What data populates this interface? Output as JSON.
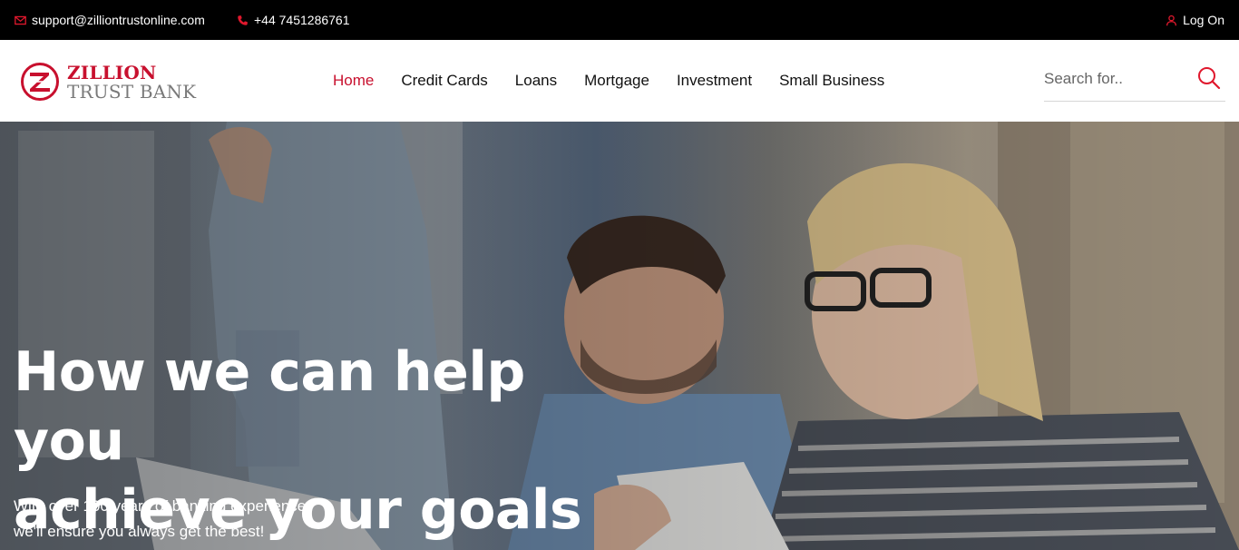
{
  "topbar": {
    "email": "support@zilliontrustonline.com",
    "phone": "+44 7451286761",
    "login_label": "Log On",
    "icons": {
      "email": "envelope-icon",
      "phone": "phone-icon",
      "login": "user-icon"
    },
    "accent_color": "#e0182d"
  },
  "header": {
    "logo": {
      "line1": "ZILLION",
      "line2": "TRUST BANK",
      "brand_color": "#c8102e"
    },
    "nav": [
      {
        "label": "Home",
        "active": true
      },
      {
        "label": "Credit Cards",
        "active": false
      },
      {
        "label": "Loans",
        "active": false
      },
      {
        "label": "Mortgage",
        "active": false
      },
      {
        "label": "Investment",
        "active": false
      },
      {
        "label": "Small Business",
        "active": false
      }
    ],
    "search": {
      "placeholder": "Search for..",
      "value": "",
      "icon": "search-icon"
    }
  },
  "hero": {
    "title_line1": "How we can help you",
    "title_line2": "achieve your goals",
    "subtitle_line1": "With over 100 years of banking experience",
    "subtitle_line2": "we'll ensure you always get the best!"
  }
}
